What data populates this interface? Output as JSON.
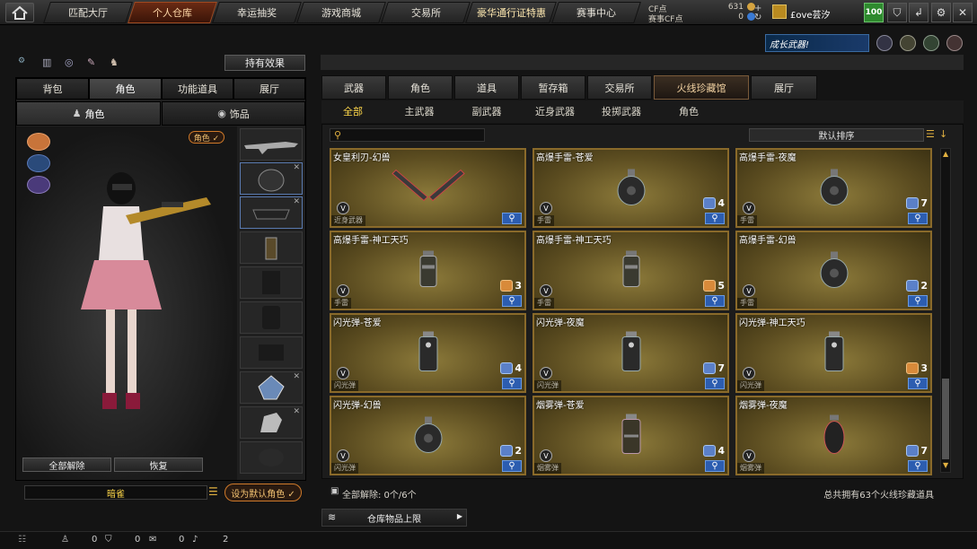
{
  "nav": {
    "tabs": [
      "匹配大厅",
      "个人仓库",
      "幸运抽奖",
      "游戏商城",
      "交易所",
      "豪华通行证特惠",
      "赛事中心"
    ],
    "active_index": 1,
    "cf_label": "CF点",
    "cf_value": "631",
    "cf_bonus_label": "赛事CF点",
    "cf_bonus_value": "0",
    "username": "£ove芸汐",
    "level_badge": "100"
  },
  "promo": {
    "banner": "成长武器!"
  },
  "left": {
    "effect_button": "持有效果",
    "tabs": [
      "背包",
      "角色",
      "功能道具",
      "展厅"
    ],
    "active_tab": 1,
    "subtabs": [
      "角色",
      "饰品"
    ],
    "role_tag": "角色 ✓",
    "unequip_all": "全部解除",
    "restore": "恢复",
    "char_name": "暗雀",
    "set_default": "设为默认角色 ✓"
  },
  "right": {
    "tabs": [
      "武器",
      "角色",
      "道具",
      "暂存箱",
      "交易所",
      "火线珍藏馆",
      "展厅"
    ],
    "active_tab": 5,
    "subtabs": [
      "全部",
      "主武器",
      "副武器",
      "近身武器",
      "投掷武器",
      "角色"
    ],
    "active_subtab": 0,
    "search_placeholder": "",
    "sort_label": "默认排序",
    "items": [
      {
        "name": "女皇利刃-幻兽",
        "type": "近身武器",
        "count": null,
        "icon": "blades",
        "badge": "blue"
      },
      {
        "name": "高爆手雷-苍爱",
        "type": "手雷",
        "count": "4",
        "icon": "grenade-round",
        "badge": "blue"
      },
      {
        "name": "高爆手雷-夜魔",
        "type": "手雷",
        "count": "7",
        "icon": "grenade-round",
        "badge": "blue"
      },
      {
        "name": "高爆手雷-神工天巧",
        "type": "手雷",
        "count": "3",
        "icon": "grenade-stick",
        "badge": "orange"
      },
      {
        "name": "高爆手雷-神工天巧",
        "type": "手雷",
        "count": "5",
        "icon": "grenade-stick",
        "badge": "orange"
      },
      {
        "name": "高爆手雷-幻兽",
        "type": "手雷",
        "count": "2",
        "icon": "grenade-round",
        "badge": "blue"
      },
      {
        "name": "闪光弹-苍爱",
        "type": "闪光弹",
        "count": "4",
        "icon": "flash",
        "badge": "blue"
      },
      {
        "name": "闪光弹-夜魔",
        "type": "闪光弹",
        "count": "7",
        "icon": "flash",
        "badge": "blue"
      },
      {
        "name": "闪光弹-神工天巧",
        "type": "闪光弹",
        "count": "3",
        "icon": "flash",
        "badge": "orange"
      },
      {
        "name": "闪光弹-幻兽",
        "type": "闪光弹",
        "count": "2",
        "icon": "grenade-round",
        "badge": "blue"
      },
      {
        "name": "烟雾弹-苍爱",
        "type": "烟雾弹",
        "count": "4",
        "icon": "smoke",
        "badge": "blue"
      },
      {
        "name": "烟雾弹-夜魔",
        "type": "烟雾弹",
        "count": "7",
        "icon": "grenade-oval",
        "badge": "blue"
      }
    ],
    "footer_left": "全部解除: 0个/6个",
    "footer_right": "总共拥有63个火线珍藏道具",
    "storage_limit": "仓库物品上限"
  },
  "bottom": {
    "val1": "0",
    "val2": "0",
    "val3": "0",
    "val4": "2"
  }
}
